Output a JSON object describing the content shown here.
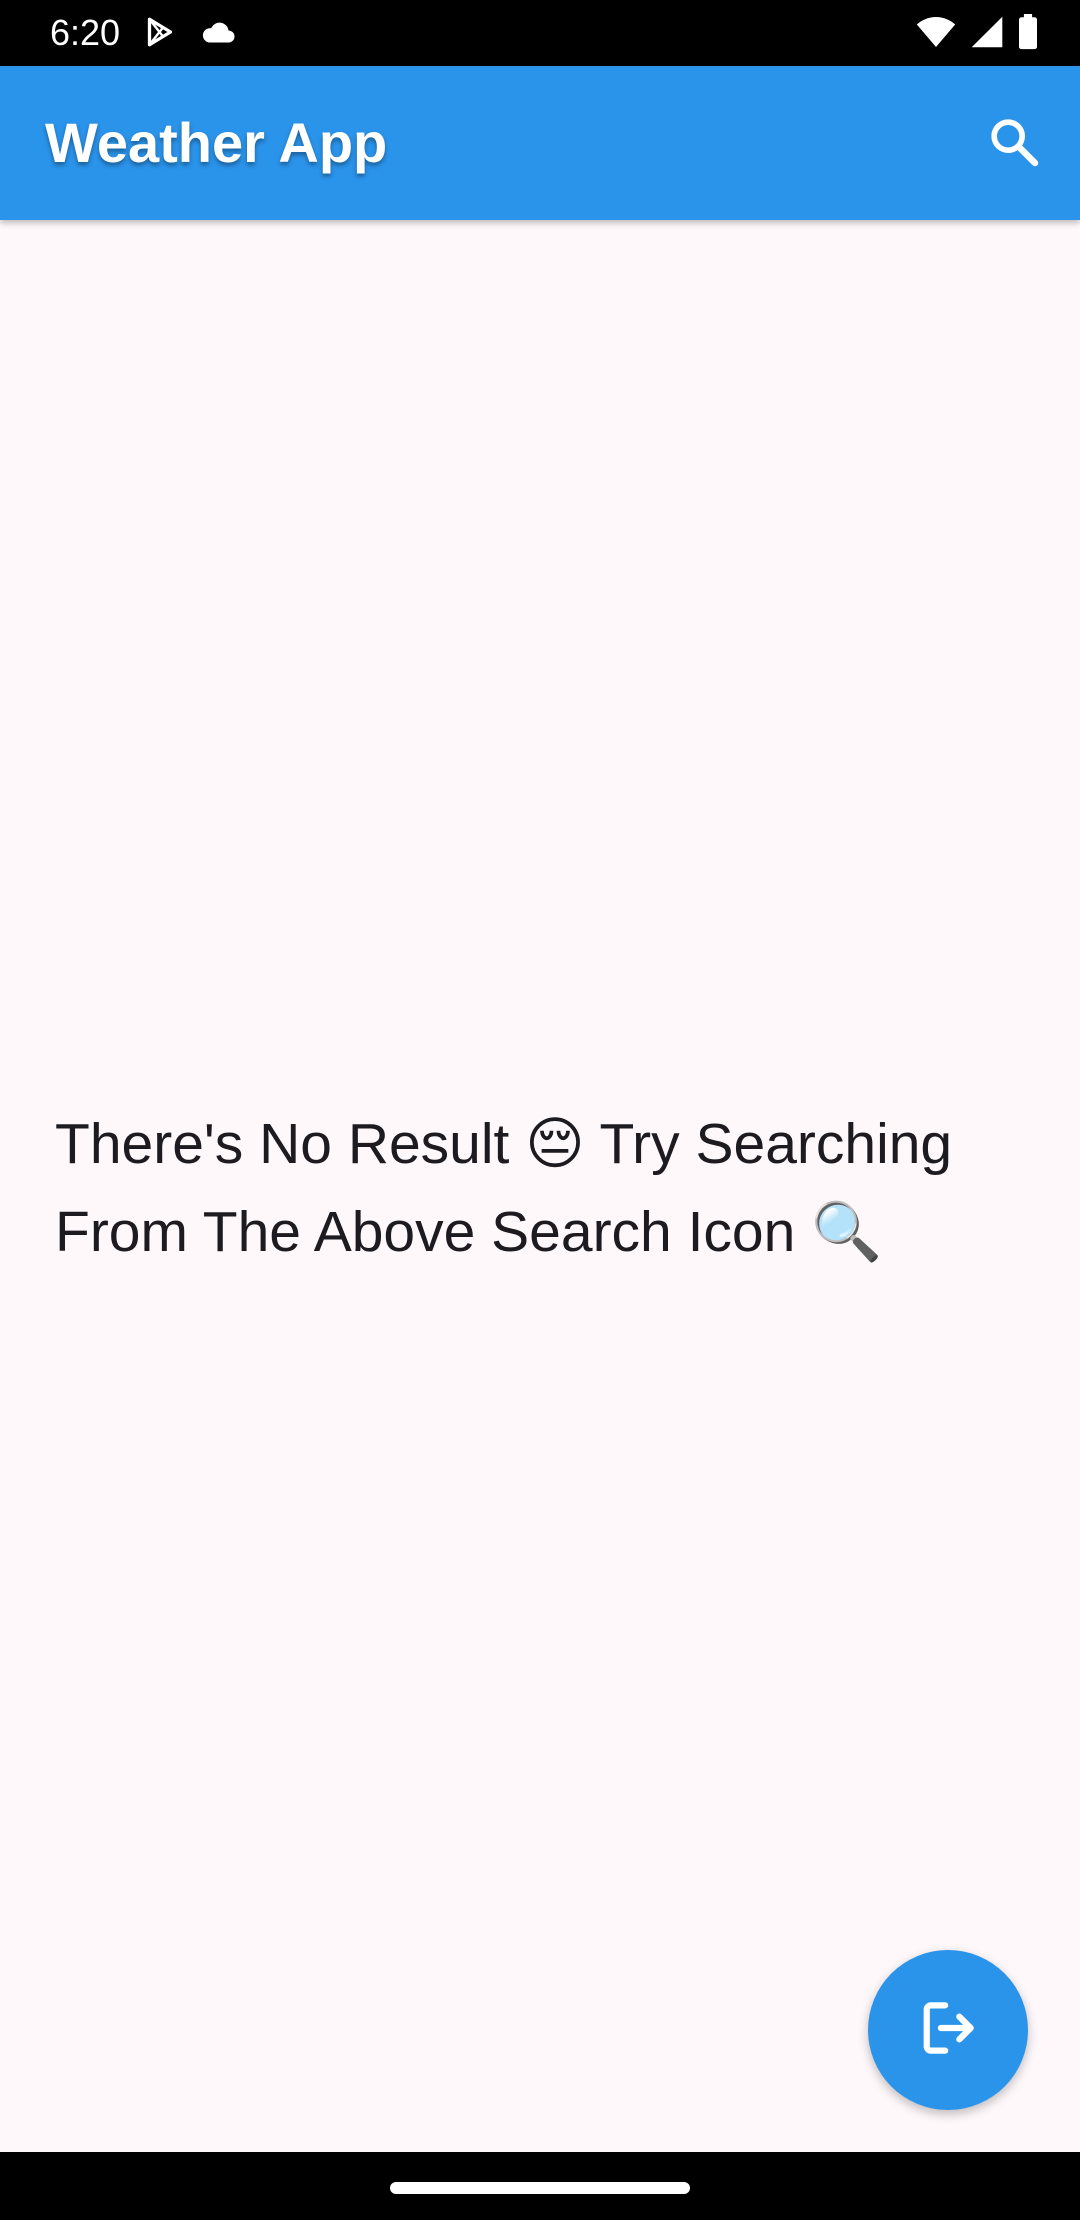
{
  "status_bar": {
    "time": "6:20",
    "left_icons": [
      "play-store-icon",
      "cloud-icon"
    ],
    "right_icons": [
      "wifi-icon",
      "cellular-signal-icon",
      "battery-icon"
    ]
  },
  "app_bar": {
    "title": "Weather App",
    "action_icon": "search-icon"
  },
  "main": {
    "empty_message": "There's No Result 😔 Try Searching From The Above Search Icon 🔍"
  },
  "fab": {
    "icon": "logout-icon"
  },
  "colors": {
    "primary": "#2a93ea",
    "background": "#fef8fb",
    "text": "#1d1b1f",
    "system_bars": "#000000"
  }
}
